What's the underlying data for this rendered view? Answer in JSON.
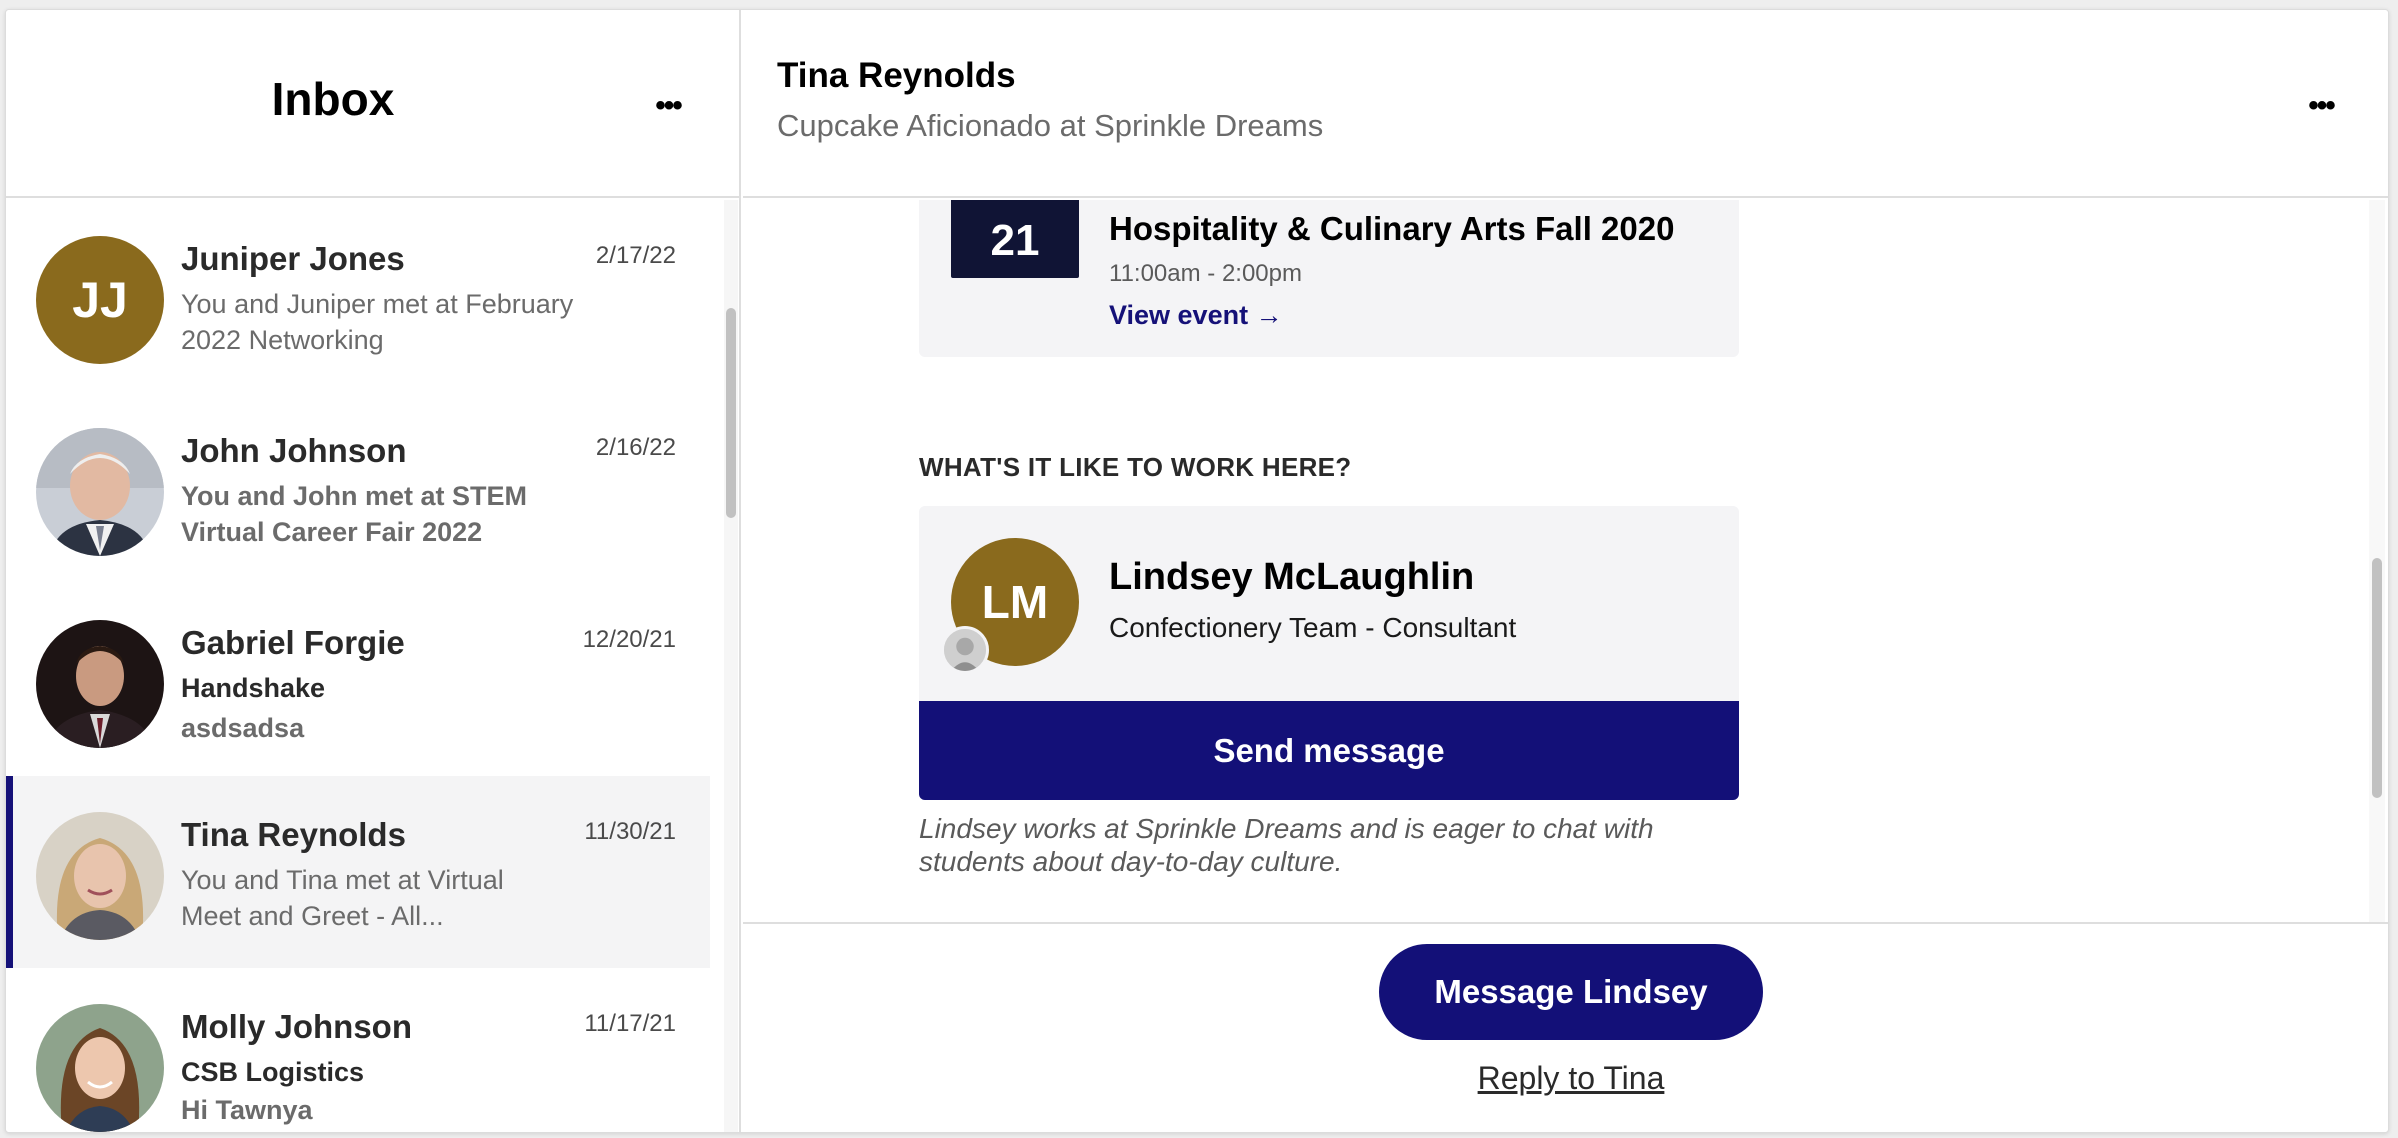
{
  "sidebar": {
    "title": "Inbox",
    "more_icon": "ellipsis-icon",
    "conversations": [
      {
        "name": "Juniper Jones",
        "date": "2/17/22",
        "initials": "JJ",
        "line1": "You and Juniper met at February",
        "line2": "2022 Networking"
      },
      {
        "name": "John Johnson",
        "date": "2/16/22",
        "line1": "You and John met at STEM",
        "line2": "Virtual Career Fair 2022"
      },
      {
        "name": "Gabriel Forgie",
        "date": "12/20/21",
        "line1": "Handshake",
        "line2": "asdsadsa"
      },
      {
        "name": "Tina Reynolds",
        "date": "11/30/21",
        "line1": "You and Tina met at Virtual",
        "line2": "Meet and Greet - All..."
      },
      {
        "name": "Molly Johnson",
        "date": "11/17/21",
        "line1": "CSB Logistics",
        "line2": "Hi Tawnya"
      }
    ]
  },
  "header": {
    "name": "Tina Reynolds",
    "title": "Cupcake Aficionado at Sprinkle Dreams",
    "more_icon": "ellipsis-icon"
  },
  "event": {
    "day": "21",
    "title": "Hospitality & Culinary Arts Fall 2020",
    "time": "11:00am - 2:00pm",
    "link_label": "View event →"
  },
  "work_here": {
    "section_label": "WHAT'S IT LIKE TO WORK HERE?",
    "initials": "LM",
    "name": "Lindsey McLaughlin",
    "role": "Confectionery Team - Consultant",
    "send_label": "Send message",
    "note": "Lindsey works at Sprinkle Dreams and is eager to chat with students about day-to-day culture."
  },
  "footer": {
    "primary_label": "Message Lindsey",
    "reply_label": "Reply to Tina"
  },
  "colors": {
    "brand_navy": "#131078",
    "avatar_gold": "#8a6a1d",
    "date_block": "#101435"
  }
}
